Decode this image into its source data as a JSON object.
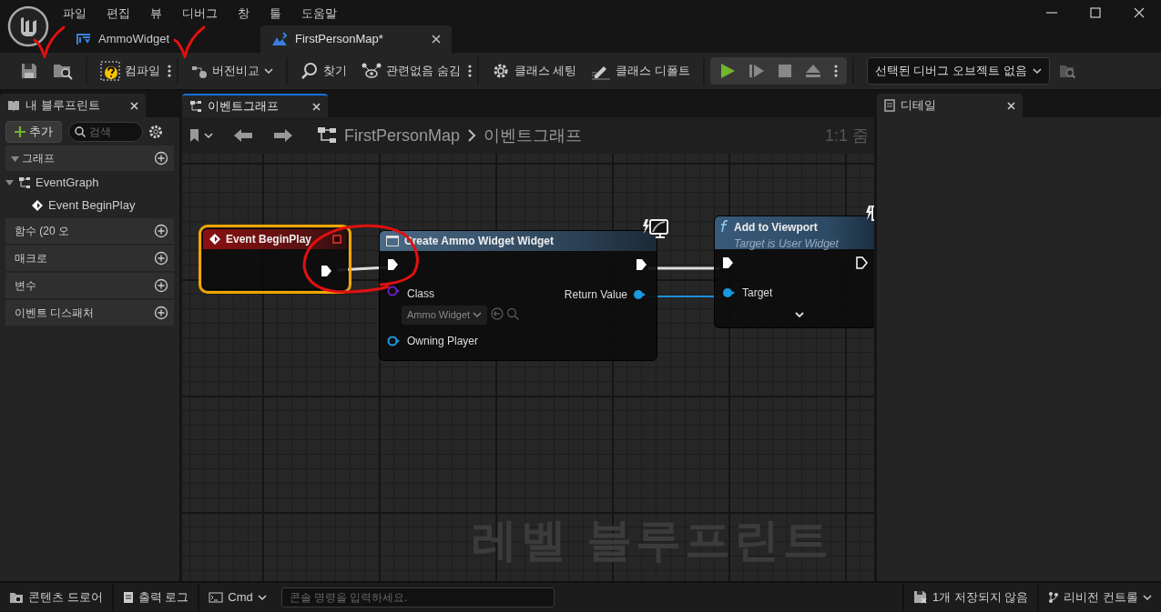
{
  "window": {
    "menu": [
      "파일",
      "편집",
      "뷰",
      "디버그",
      "창",
      "툴",
      "도움말"
    ],
    "tabs": [
      {
        "label": "AmmoWidget",
        "selected": false
      },
      {
        "label": "FirstPersonMap*",
        "selected": true
      }
    ]
  },
  "toolbar": {
    "compile": "컴파일",
    "diff": "버전비교",
    "find": "찾기",
    "hide_unrelated": "관련없음 숨김",
    "class_settings": "클래스 세팅",
    "class_defaults": "클래스 디폴트",
    "debug_object": "선택된 디버그 오브젝트 없음"
  },
  "my_blueprint": {
    "title": "내 블루프린트",
    "add": "추가",
    "search_placeholder": "검색",
    "sections": [
      {
        "label": "그래프",
        "expanded": true,
        "children": [
          {
            "label": "EventGraph",
            "expanded": true,
            "children": [
              {
                "label": "Event BeginPlay"
              }
            ]
          }
        ]
      },
      {
        "label": "함수 (20 오"
      },
      {
        "label": "매크로"
      },
      {
        "label": "변수"
      },
      {
        "label": "이벤트 디스패처"
      }
    ]
  },
  "graph": {
    "tab": "이벤트그래프",
    "breadcrumb": [
      "FirstPersonMap",
      "이벤트그래프"
    ],
    "zoom": "1:1 줌",
    "watermark": "레벨 블루프린트",
    "nodes": [
      {
        "kind": "event",
        "title": "Event BeginPlay",
        "selected": true
      },
      {
        "kind": "construct",
        "title": "Create Ammo Widget Widget",
        "selected": false,
        "inputs": [
          {
            "label": "Class",
            "kind": "class",
            "connected": false,
            "value": "Ammo Widget"
          },
          {
            "label": "Owning Player",
            "kind": "object",
            "connected": false
          }
        ],
        "outputs": [
          {
            "label": "Return Value",
            "kind": "object",
            "connected": true
          }
        ]
      },
      {
        "kind": "function",
        "title": "Add to Viewport",
        "subtitle": "Target is User Widget",
        "selected": false,
        "inputs": [
          {
            "label": "Target",
            "kind": "object",
            "connected": true
          }
        ]
      }
    ]
  },
  "details": {
    "title": "디테일"
  },
  "status_bar": {
    "content_drawer": "콘텐츠 드로어",
    "output_log": "출력 로그",
    "cmd": "Cmd",
    "console_placeholder": "콘솔 명령을 입력하세요.",
    "unsaved": "1개 저장되지 않음",
    "revision_control": "리비전 컨트롤"
  }
}
